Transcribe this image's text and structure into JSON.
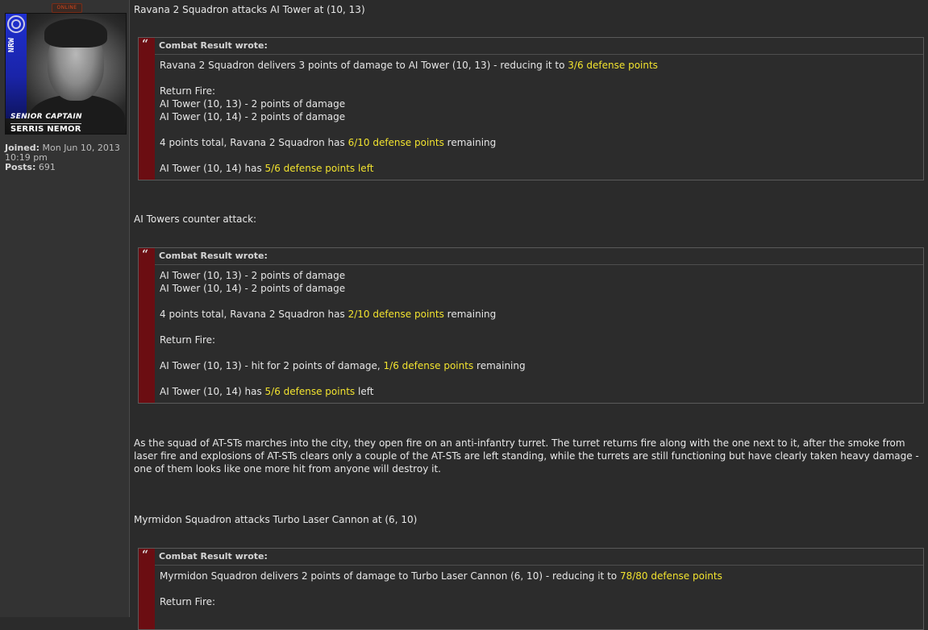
{
  "profile": {
    "online_badge": "ONLINE",
    "avatar_stripe_text": "NRW",
    "avatar_rank": "SENIOR CAPTAIN",
    "avatar_name": "SERRIS NEMOR",
    "joined_label": "Joined:",
    "joined_value": "Mon Jun 10, 2013 10:19 pm",
    "posts_label": "Posts:",
    "posts_value": "691"
  },
  "post": {
    "line1": "Ravana 2 Squadron attacks AI Tower at (10, 13)",
    "quote1": {
      "header": "Combat Result wrote:",
      "l1_a": "Ravana 2 Squadron delivers 3 points of damage to AI Tower (10, 13) - reducing it to ",
      "l1_hl": "3/6 defense points",
      "l2": "Return Fire:",
      "l3": "AI Tower (10, 13) - 2 points of damage",
      "l4": "AI Tower (10, 14) - 2 points of damage",
      "l5_a": "4 points total, Ravana 2 Squadron has ",
      "l5_hl": "6/10 defense points",
      "l5_b": " remaining",
      "l6_a": "AI Tower (10, 14) has ",
      "l6_hl": "5/6 defense points left"
    },
    "line2": "AI Towers counter attack:",
    "quote2": {
      "header": "Combat Result wrote:",
      "l1": "AI Tower (10, 13) - 2 points of damage",
      "l2": "AI Tower (10, 14) - 2 points of damage",
      "l3_a": "4 points total, Ravana 2 Squadron has ",
      "l3_hl": "2/10 defense points",
      "l3_b": " remaining",
      "l4": "Return Fire:",
      "l5_a": "AI Tower (10, 13) - hit for 2 points of damage, ",
      "l5_hl": "1/6 defense points",
      "l5_b": " remaining",
      "l6_a": "AI Tower (10, 14) has ",
      "l6_hl": "5/6 defense points",
      "l6_b": " left"
    },
    "narrative": "As the squad of AT-STs marches into the city, they open fire on an anti-infantry turret. The turret returns fire along with the one next to it, after the smoke from laser fire and explosions of AT-STs clears only a couple of the AT-STs are left standing, while the turrets are still functioning but have clearly taken heavy damage - one of them looks like one more hit from anyone will destroy it.",
    "line3": "Myrmidon Squadron attacks Turbo Laser Cannon at (6, 10)",
    "quote3": {
      "header": "Combat Result wrote:",
      "l1_a": "Myrmidon Squadron delivers 2 points of damage to Turbo Laser Cannon (6, 10) - reducing it to ",
      "l1_hl": "78/80 defense points",
      "l2": "Return Fire:"
    }
  },
  "colors": {
    "background": "#2b2b2b",
    "sidebar": "#333333",
    "quote_bar": "#6b0d12",
    "highlight": "#f2e32f",
    "online_badge": "#d8451a"
  }
}
